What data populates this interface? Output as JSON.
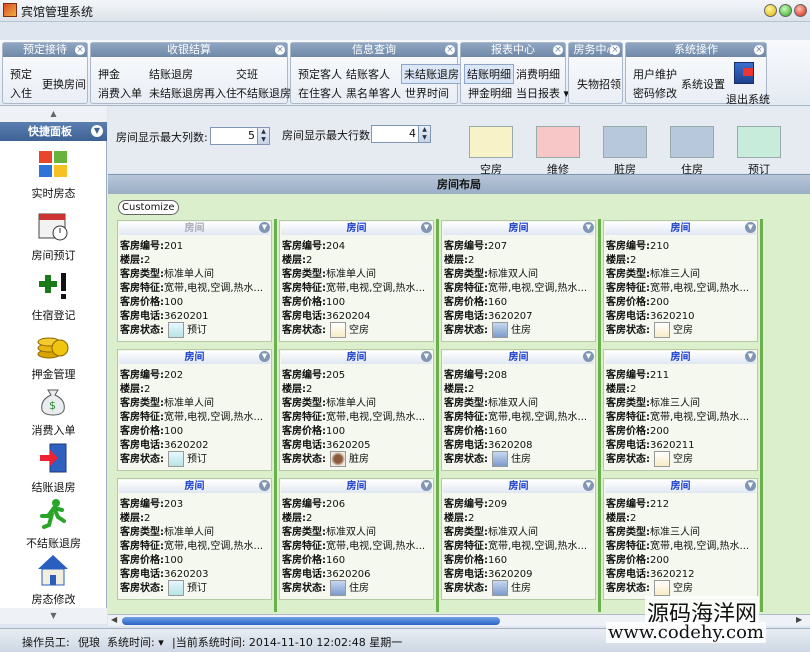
{
  "window": {
    "title": "宾馆管理系统"
  },
  "ribbon": {
    "groups": [
      {
        "title": "预定接待",
        "buttons": [
          "预定",
          "入住",
          "更换房间"
        ]
      },
      {
        "title": "收银结算",
        "buttons": [
          "押金",
          "结账退房",
          "交班",
          "消费入单",
          "未结账退房再入住",
          "不结账退房"
        ]
      },
      {
        "title": "信息查询",
        "buttons": [
          "预定客人",
          "结账客人",
          "未结账退房",
          "在住客人",
          "黑名单客人",
          "世界时间"
        ]
      },
      {
        "title": "报表中心",
        "buttons": [
          "结账明细",
          "消费明细",
          "押金明细",
          "当日报表"
        ]
      },
      {
        "title": "房务中心",
        "buttons": [
          "失物招领"
        ]
      },
      {
        "title": "系统操作",
        "buttons": [
          "用户维护",
          "系统设置",
          "密码修改",
          "退出系统"
        ]
      }
    ]
  },
  "sidebar": {
    "title": "快捷面板",
    "items": [
      "实时房态",
      "房间预订",
      "住宿登记",
      "押金管理",
      "消费入单",
      "结账退房",
      "不结账退房",
      "房态修改"
    ]
  },
  "settings": {
    "max_cols_label": "房间显示最大列数:",
    "max_cols_value": "5",
    "max_rows_label": "房间显示最大行数:",
    "max_rows_value": "4"
  },
  "legend": [
    {
      "label": "空房",
      "color": "#f8f2c8"
    },
    {
      "label": "维修",
      "color": "#f7c7c7"
    },
    {
      "label": "脏房",
      "color": "#b7c8dc"
    },
    {
      "label": "住房",
      "color": "#b7c8dc"
    },
    {
      "label": "预订",
      "color": "#c8ecdc"
    }
  ],
  "layout": {
    "title": "房间布局",
    "customize": "Customize",
    "field_labels": {
      "id": "客房编号:",
      "floor": "楼层:",
      "type": "客房类型:",
      "features": "客房特征:",
      "price": "客房价格:",
      "phone": "客房电话:",
      "status": "客房状态:"
    },
    "card_title": "房间",
    "rooms": [
      {
        "id": "201",
        "floor": "2",
        "type": "标准单人间",
        "features": "宽带,电视,空调,热水...",
        "price": "100",
        "phone": "3620201",
        "status": "预订"
      },
      {
        "id": "202",
        "floor": "2",
        "type": "标准单人间",
        "features": "宽带,电视,空调,热水...",
        "price": "100",
        "phone": "3620202",
        "status": "预订"
      },
      {
        "id": "203",
        "floor": "2",
        "type": "标准单人间",
        "features": "宽带,电视,空调,热水...",
        "price": "100",
        "phone": "3620203",
        "status": "预订"
      },
      {
        "id": "204",
        "floor": "2",
        "type": "标准单人间",
        "features": "宽带,电视,空调,热水...",
        "price": "100",
        "phone": "3620204",
        "status": "空房"
      },
      {
        "id": "205",
        "floor": "2",
        "type": "标准单人间",
        "features": "宽带,电视,空调,热水...",
        "price": "100",
        "phone": "3620205",
        "status": "脏房"
      },
      {
        "id": "206",
        "floor": "2",
        "type": "标准双人间",
        "features": "宽带,电视,空调,热水...",
        "price": "160",
        "phone": "3620206",
        "status": "住房"
      },
      {
        "id": "207",
        "floor": "2",
        "type": "标准双人间",
        "features": "宽带,电视,空调,热水...",
        "price": "160",
        "phone": "3620207",
        "status": "住房"
      },
      {
        "id": "208",
        "floor": "2",
        "type": "标准双人间",
        "features": "宽带,电视,空调,热水...",
        "price": "160",
        "phone": "3620208",
        "status": "住房"
      },
      {
        "id": "209",
        "floor": "2",
        "type": "标准双人间",
        "features": "宽带,电视,空调,热水...",
        "price": "160",
        "phone": "3620209",
        "status": "住房"
      },
      {
        "id": "210",
        "floor": "2",
        "type": "标准三人间",
        "features": "宽带,电视,空调,热水...",
        "price": "200",
        "phone": "3620210",
        "status": "空房"
      },
      {
        "id": "211",
        "floor": "2",
        "type": "标准三人间",
        "features": "宽带,电视,空调,热水...",
        "price": "200",
        "phone": "3620211",
        "status": "空房"
      },
      {
        "id": "212",
        "floor": "2",
        "type": "标准三人间",
        "features": "宽带,电视,空调,热水...",
        "price": "200",
        "phone": "3620212",
        "status": "空房"
      }
    ]
  },
  "statusbar": {
    "operator_label": "操作员工:",
    "operator": "倪琅",
    "time_label": "系统时间:",
    "current_time": "|当前系统时间: 2014-11-10 12:02:48 星期一"
  },
  "watermark": {
    "line1": "源码海洋网",
    "line2": "www.codehy.com"
  }
}
